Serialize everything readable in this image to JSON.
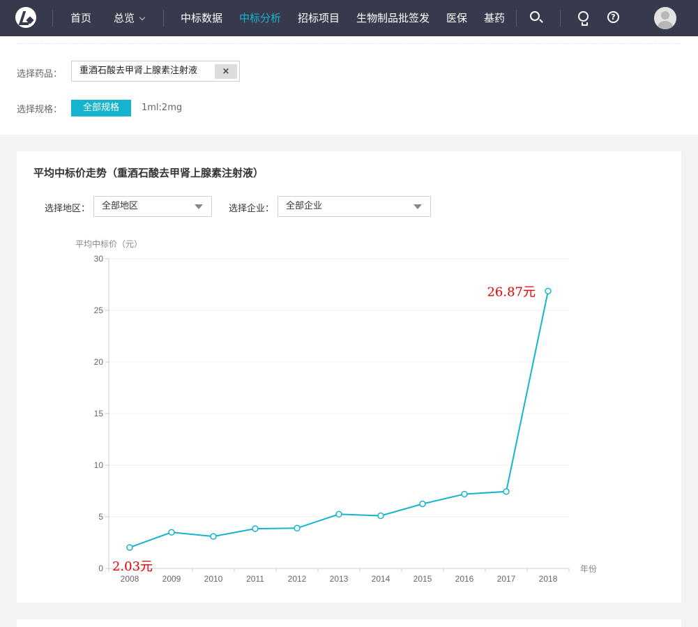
{
  "nav": {
    "items": [
      {
        "label": "首页",
        "active": false
      },
      {
        "label": "总览",
        "active": false,
        "dropdown": true
      },
      {
        "label": "中标数据",
        "active": false
      },
      {
        "label": "中标分析",
        "active": true
      },
      {
        "label": "招标项目",
        "active": false
      },
      {
        "label": "生物制品批签发",
        "active": false
      },
      {
        "label": "医保",
        "active": false
      },
      {
        "label": "基药",
        "active": false
      }
    ],
    "icons": [
      "search-icon",
      "lightbulb-icon",
      "help-icon",
      "avatar"
    ]
  },
  "filters": {
    "drug_label": "选择药品：",
    "drug_value": "重酒石酸去甲肾上腺素注射液",
    "clear_label": "×",
    "spec_label": "选择规格：",
    "spec_active": "全部规格",
    "spec_option": "1ml:2mg"
  },
  "card": {
    "title": "平均中标价走势（重酒石酸去甲肾上腺素注射液）",
    "region_label": "选择地区：",
    "region_value": "全部地区",
    "company_label": "选择企业：",
    "company_value": "全部企业"
  },
  "colors": {
    "nav_bg": "#373a4d",
    "accent": "#15b4cc",
    "annotation": "#e60000"
  },
  "chart_data": {
    "type": "line",
    "ylabel": "平均中标价（元）",
    "xlabel": "年份",
    "ylim": [
      0,
      30
    ],
    "yticks": [
      0,
      5,
      10,
      15,
      20,
      25,
      30
    ],
    "categories": [
      "2008",
      "2009",
      "2010",
      "2011",
      "2012",
      "2013",
      "2014",
      "2015",
      "2016",
      "2017",
      "2018"
    ],
    "series": [
      {
        "values": [
          2.03,
          3.5,
          3.1,
          3.85,
          3.9,
          5.25,
          5.1,
          6.25,
          7.2,
          7.45,
          26.87
        ]
      }
    ],
    "annotations": [
      {
        "category": "2018",
        "text": "26.87元"
      },
      {
        "category": "2008",
        "text": "2.03元"
      }
    ],
    "grid": true
  }
}
